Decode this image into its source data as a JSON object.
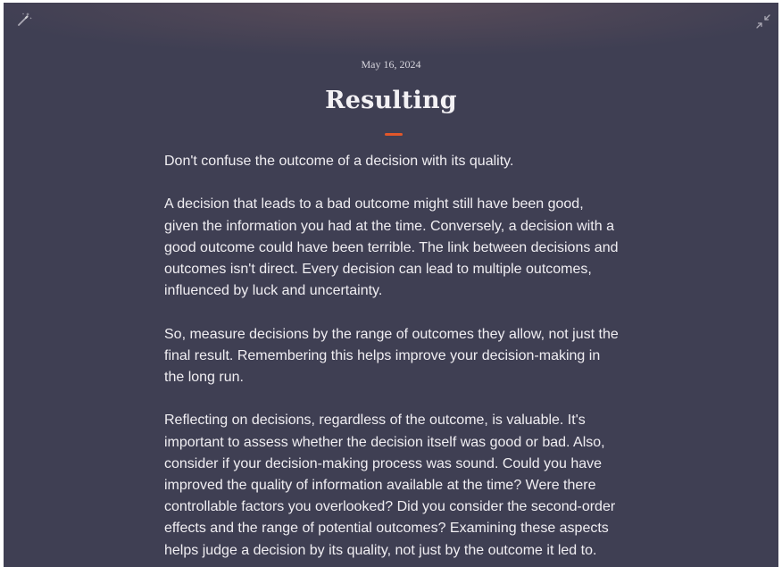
{
  "note": {
    "date": "May 16, 2024",
    "title": "Resulting",
    "paragraphs": [
      "Don't confuse the outcome of a decision with its quality.",
      "A decision that leads to a bad outcome might still have been good, given the information you had at the time. Conversely, a decision with a good outcome could have been terrible. The link between decisions and outcomes isn't direct. Every decision can lead to multiple outcomes, influenced by luck and uncertainty.",
      "So, measure decisions by the range of outcomes they allow, not just the final result. Remembering this helps improve your decision-making in the long run.",
      "Reflecting on decisions, regardless of the outcome, is valuable. It's important to assess whether the decision itself was good or bad. Also, consider if your decision-making process was sound. Could you have improved the quality of information available at the time? Were there controllable factors you overlooked? Did you consider the second-order effects and the range of potential outcomes? Examining these aspects helps judge a decision by its quality, not just by the outcome it led to."
    ]
  },
  "toolbar": {
    "left_icon": "magic-wand-icon",
    "right_icon": "collapse-icon"
  },
  "colors": {
    "background": "#3f3f53",
    "accent": "#e2572a",
    "text": "#f0eef2"
  }
}
